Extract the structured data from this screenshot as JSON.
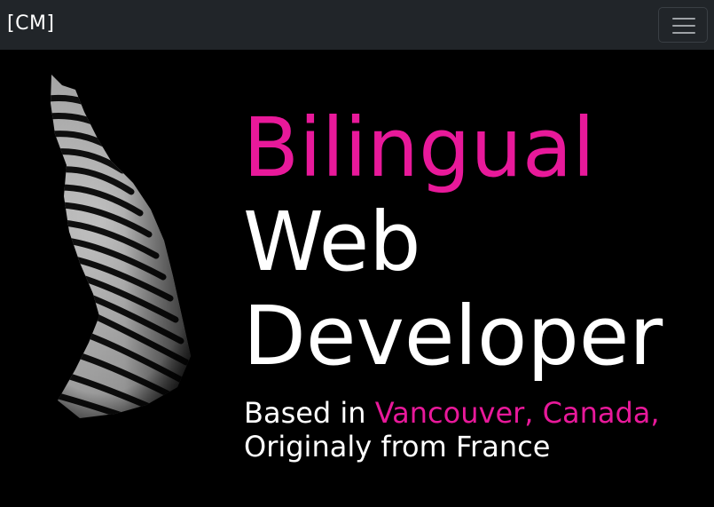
{
  "navbar": {
    "brand": "[CM]",
    "toggler_icon": "hamburger-icon"
  },
  "hero": {
    "image": "zebra-portrait",
    "headline": {
      "line1": "Bilingual",
      "line2": "Web",
      "line3": "Developer"
    },
    "sub": {
      "prefix": "Based in ",
      "location": "Vancouver, Canada,",
      "line2": "Originaly from France"
    }
  },
  "colors": {
    "accent": "#e8199a",
    "navbar_bg": "#212529",
    "background": "#000000",
    "text": "#ffffff"
  }
}
